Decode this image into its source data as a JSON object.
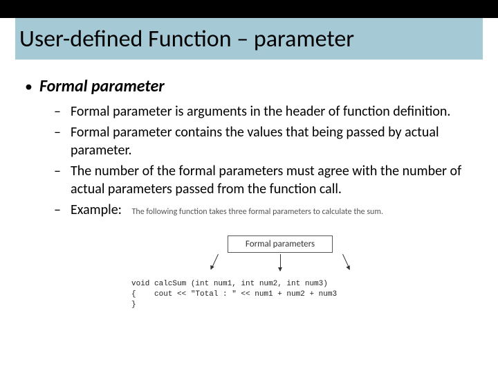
{
  "title": "User-defined Function – parameter",
  "heading": "Formal parameter",
  "points": [
    "Formal parameter is arguments in the header of function definition.",
    "Formal parameter contains the values that being passed by actual parameter.",
    "The number of the formal parameters must agree with the number of actual parameters passed from the function call.",
    "Example:"
  ],
  "example_caption": "The following function takes three formal parameters to calculate the sum.",
  "diagram_label": "Formal parameters",
  "code": {
    "l1": "void calcSum (int num1, int num2, int num3)",
    "l2": "{    cout << \"Total : \" << num1 + num2 + num3",
    "l3": "}"
  }
}
